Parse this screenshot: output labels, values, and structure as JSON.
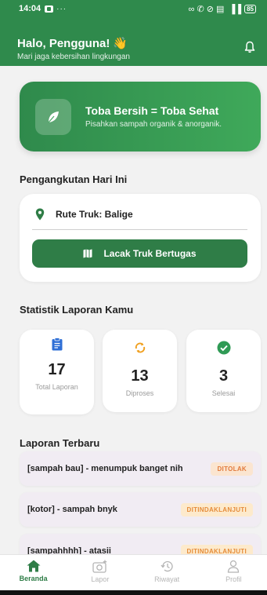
{
  "status_bar": {
    "time": "14:04",
    "dots": "···",
    "right_icons": "∞ ✆ ⊘ ▤  ▐▐",
    "battery": "85"
  },
  "header": {
    "greeting": "Halo, Pengguna!",
    "wave": "👋",
    "subtitle": "Mari jaga kebersihan lingkungan"
  },
  "hero": {
    "title": "Toba Bersih = Toba Sehat",
    "subtitle": "Pisahkan sampah organik & anorganik."
  },
  "transport": {
    "section_title": "Pengangkutan Hari Ini",
    "route_label": "Rute Truk: Balige",
    "track_button": "Lacak Truk Bertugas"
  },
  "stats": {
    "section_title": "Statistik Laporan Kamu",
    "items": [
      {
        "value": "17",
        "label": "Total Laporan",
        "icon": "clipboard-icon",
        "color": "#2f6fd6"
      },
      {
        "value": "13",
        "label": "Diproses",
        "icon": "sync-icon",
        "color": "#f0a020"
      },
      {
        "value": "3",
        "label": "Selesai",
        "icon": "check-circle-icon",
        "color": "#2f9a55"
      }
    ]
  },
  "recent": {
    "section_title": "Laporan Terbaru",
    "items": [
      {
        "title": "[sampah bau] - menumpuk banget nih",
        "status": "DITOLAK"
      },
      {
        "title": "[kotor] - sampah bnyk",
        "status": "DITINDAKLANJUTI"
      },
      {
        "title": "[sampahhhh] - atasii",
        "status": "DITINDAKLANJUTI"
      }
    ]
  },
  "nav": {
    "items": [
      {
        "label": "Beranda",
        "icon": "home-icon",
        "active": true
      },
      {
        "label": "Lapor",
        "icon": "camera-add-icon",
        "active": false
      },
      {
        "label": "Riwayat",
        "icon": "history-icon",
        "active": false
      },
      {
        "label": "Profil",
        "icon": "person-icon",
        "active": false
      }
    ]
  },
  "colors": {
    "primary": "#2f8a4c",
    "button": "#2f7d47",
    "rejected": "#e27a3c",
    "followup": "#e58c3a"
  }
}
